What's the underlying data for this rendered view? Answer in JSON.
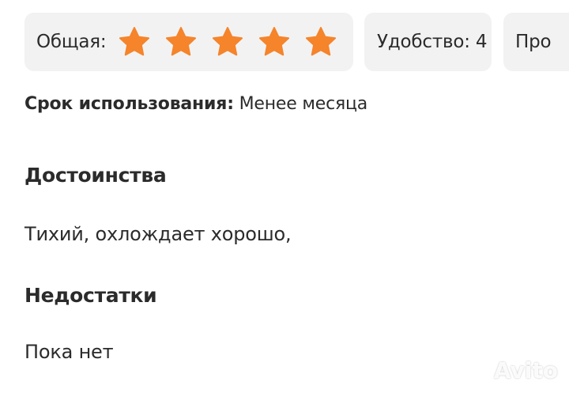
{
  "ratings": {
    "overall_label": "Общая:",
    "overall_stars": 5,
    "overall_max": 5,
    "comfort_label": "Удобство: 4",
    "third_label_partial": "Про"
  },
  "usage": {
    "label": "Срок использования:",
    "value": "Менее месяца"
  },
  "pros": {
    "heading": "Достоинства",
    "text": "Тихий, охлождает хорошо,"
  },
  "cons": {
    "heading": "Недостатки",
    "text": "Пока нет"
  },
  "watermark": {
    "text": "Avito"
  },
  "colors": {
    "star": "#f5842b",
    "chip_bg": "#f2f2f2",
    "text": "#2b2b2b"
  }
}
